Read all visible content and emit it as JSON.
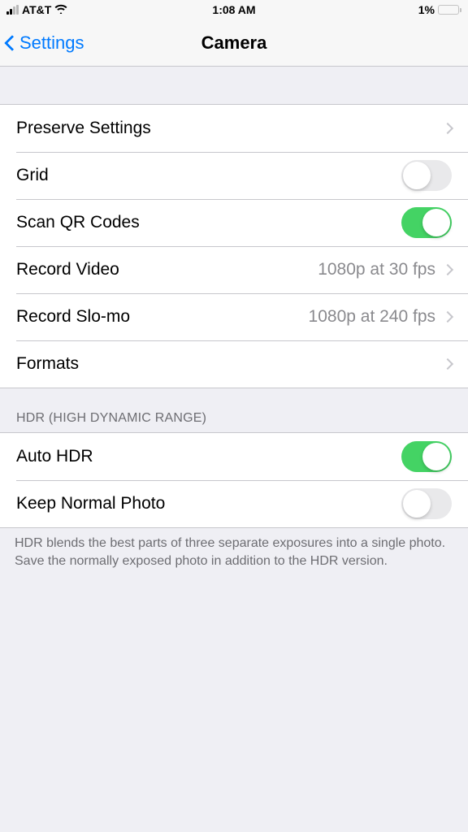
{
  "statusBar": {
    "carrier": "AT&T",
    "time": "1:08 AM",
    "batteryPercent": "1%"
  },
  "nav": {
    "backLabel": "Settings",
    "title": "Camera"
  },
  "section1": {
    "rows": {
      "preserve": {
        "label": "Preserve Settings"
      },
      "grid": {
        "label": "Grid",
        "on": false
      },
      "scanQr": {
        "label": "Scan QR Codes",
        "on": true
      },
      "recordVideo": {
        "label": "Record Video",
        "value": "1080p at 30 fps"
      },
      "recordSlomo": {
        "label": "Record Slo-mo",
        "value": "1080p at 240 fps"
      },
      "formats": {
        "label": "Formats"
      }
    }
  },
  "section2": {
    "header": "HDR (HIGH DYNAMIC RANGE)",
    "rows": {
      "autoHdr": {
        "label": "Auto HDR",
        "on": true
      },
      "keepNormal": {
        "label": "Keep Normal Photo",
        "on": false
      }
    },
    "footer": "HDR blends the best parts of three separate exposures into a single photo. Save the normally exposed photo in addition to the HDR version."
  }
}
